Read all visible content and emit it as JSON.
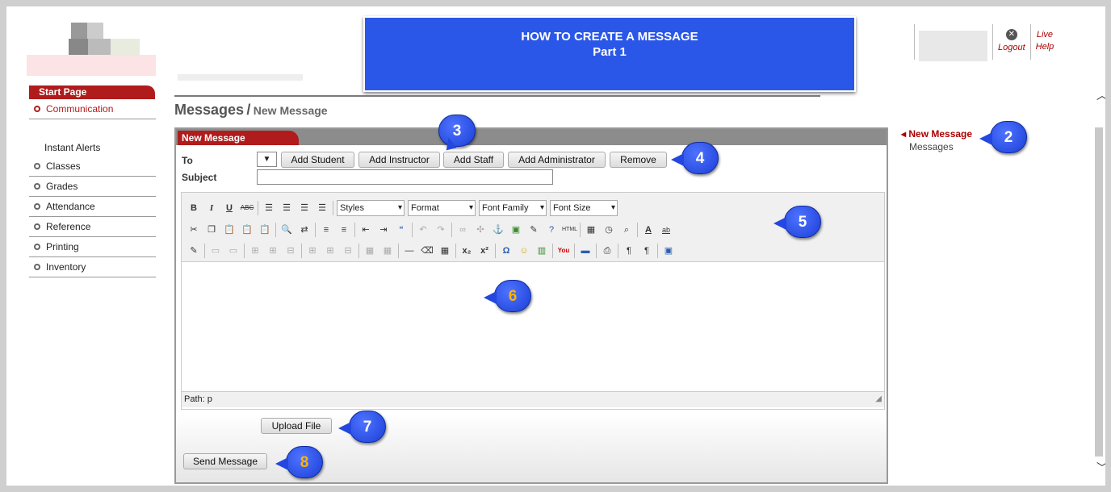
{
  "banner": {
    "line1": "HOW TO CREATE A MESSAGE",
    "line2": "Part 1"
  },
  "topright": {
    "logout": "Logout",
    "live": "Live",
    "help": "Help"
  },
  "sidebar": {
    "header": "Start Page",
    "first_item": "Communication",
    "alerts": "Instant Alerts",
    "items": [
      "Classes",
      "Grades",
      "Attendance",
      "Reference",
      "Printing",
      "Inventory"
    ]
  },
  "breadcrumb": {
    "section": "Messages",
    "sep": "/",
    "page": "New Message"
  },
  "panel": {
    "tab": "New Message",
    "to_label": "To",
    "subject_label": "Subject",
    "buttons": {
      "add_student": "Add Student",
      "add_instructor": "Add Instructor",
      "add_staff": "Add Staff",
      "add_admin": "Add Administrator",
      "remove": "Remove"
    },
    "editor": {
      "styles": "Styles",
      "format": "Format",
      "font_family": "Font Family",
      "font_size": "Font Size",
      "path": "Path: p"
    },
    "upload": "Upload File",
    "send": "Send Message"
  },
  "right_nav": {
    "active": "New Message",
    "item": "Messages"
  },
  "callouts": [
    "2",
    "3",
    "4",
    "5",
    "6",
    "7",
    "8"
  ],
  "colors": {
    "banner": "#2b57e8",
    "brand_red": "#b01c1c",
    "callout": "#2447e0"
  }
}
